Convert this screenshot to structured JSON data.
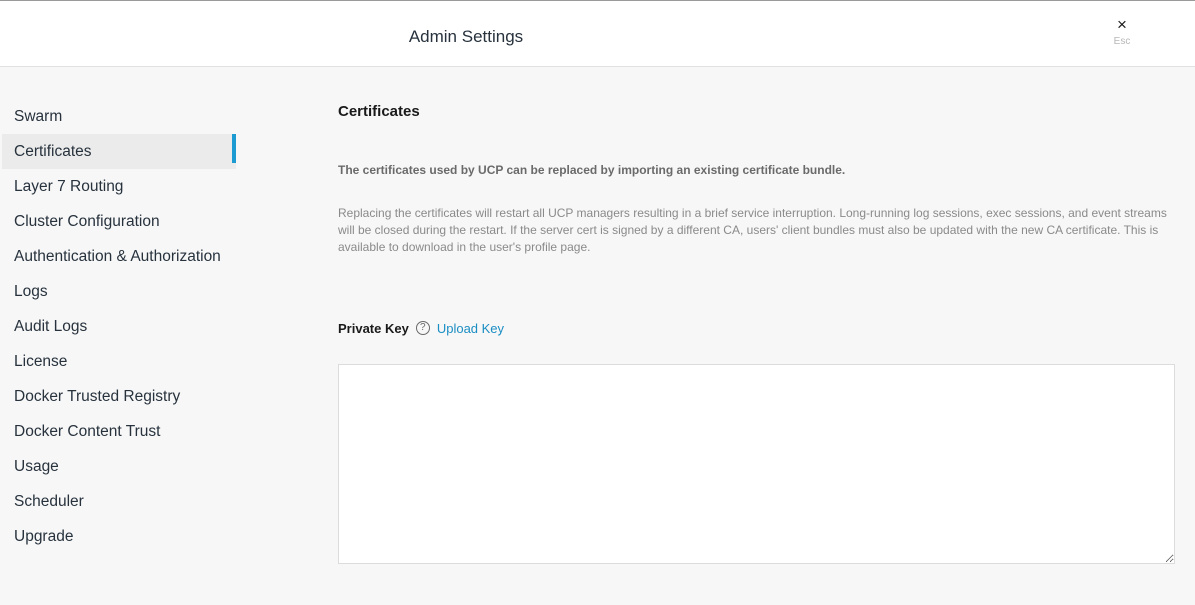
{
  "header": {
    "title": "Admin Settings",
    "close_icon": "×",
    "close_hint": "Esc"
  },
  "sidebar": {
    "items": [
      {
        "label": "Swarm"
      },
      {
        "label": "Certificates"
      },
      {
        "label": "Layer 7 Routing"
      },
      {
        "label": "Cluster Configuration"
      },
      {
        "label": "Authentication & Authorization"
      },
      {
        "label": "Logs"
      },
      {
        "label": "Audit Logs"
      },
      {
        "label": "License"
      },
      {
        "label": "Docker Trusted Registry"
      },
      {
        "label": "Docker Content Trust"
      },
      {
        "label": "Usage"
      },
      {
        "label": "Scheduler"
      },
      {
        "label": "Upgrade"
      }
    ],
    "active_index": 1
  },
  "main": {
    "title": "Certificates",
    "lead": "The certificates used by UCP can be replaced by importing an existing certificate bundle.",
    "description": "Replacing the certificates will restart all UCP managers resulting in a brief service interruption. Long-running log sessions, exec sessions, and event streams will be closed during the restart. If the server cert is signed by a different CA, users' client bundles must also be updated with the new CA certificate. This is available to download in the user's profile page.",
    "private_key": {
      "label": "Private Key",
      "help_icon": "?",
      "upload_label": "Upload Key",
      "value": ""
    }
  },
  "colors": {
    "accent": "#1b9bd1",
    "link": "#1b8ec3",
    "background": "#f7f7f7"
  }
}
